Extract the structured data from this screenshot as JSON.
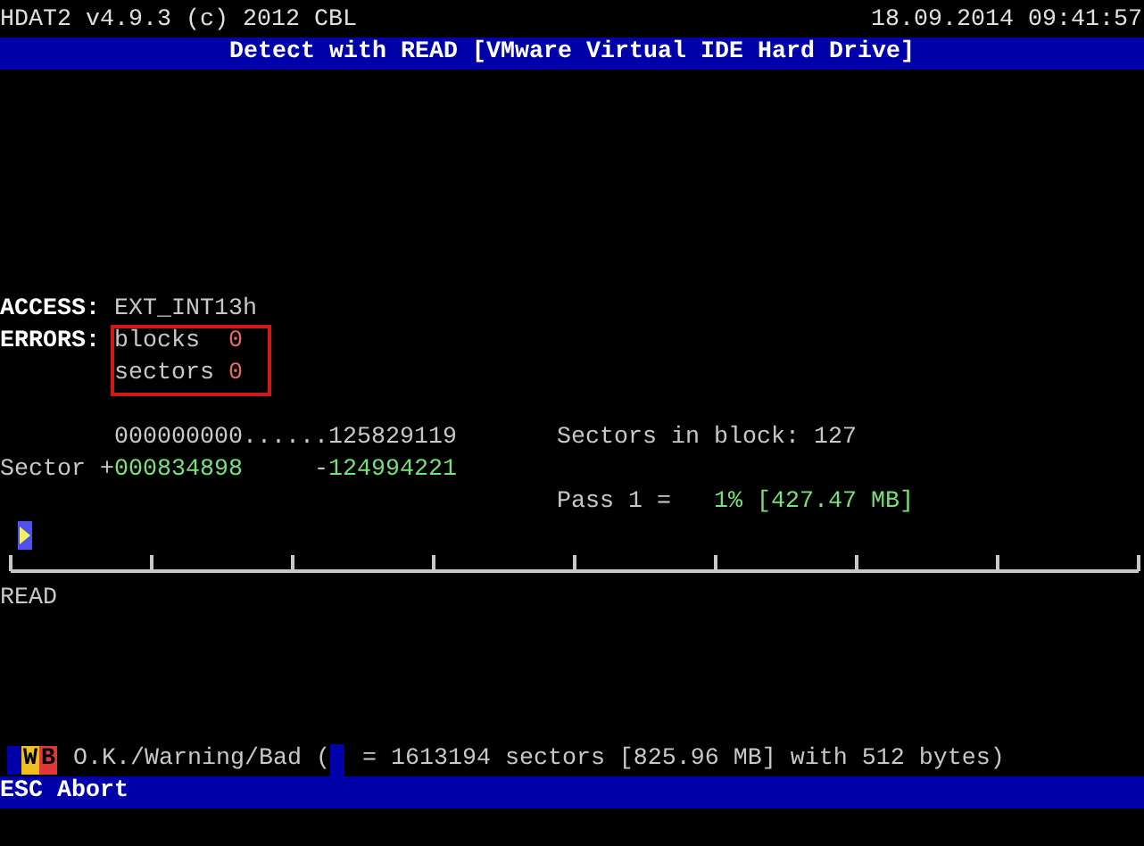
{
  "header": {
    "title": "HDAT2 v4.9.3 (c) 2012 CBL",
    "datetime": "18.09.2014 09:41:57"
  },
  "banner": "Detect with READ [VMware Virtual IDE Hard Drive]",
  "access": {
    "label": "ACCESS:",
    "value": "EXT_INT13h"
  },
  "errors": {
    "label": "ERRORS:",
    "items": [
      {
        "name": "blocks",
        "count": "0"
      },
      {
        "name": "sectors",
        "count": "0"
      }
    ]
  },
  "range": "000000000......125829119",
  "sectors_in_block": "Sectors in block: 127",
  "position": {
    "label": "Sector",
    "done_sign": "+",
    "done": "000834898",
    "remaining_sign": "-",
    "remaining": "124994221"
  },
  "pass": {
    "label": "Pass 1 =",
    "reading": "1% [427.47 MB]"
  },
  "progress": {
    "level": 0.01
  },
  "operation": "READ",
  "legend": {
    "swatches": [
      {
        "color": "#0000aa"
      },
      {
        "letter": "W",
        "color": "#f0c020"
      },
      {
        "letter": "B",
        "color": "#e03838"
      }
    ],
    "label": "O.K./Warning/Bad (",
    "unit": {
      "color": "#0000aa"
    },
    "description": "= 1613194 sectors [825.96 MB] with 512 bytes)"
  },
  "footer": {
    "key": "ESC",
    "action": "Abort"
  }
}
